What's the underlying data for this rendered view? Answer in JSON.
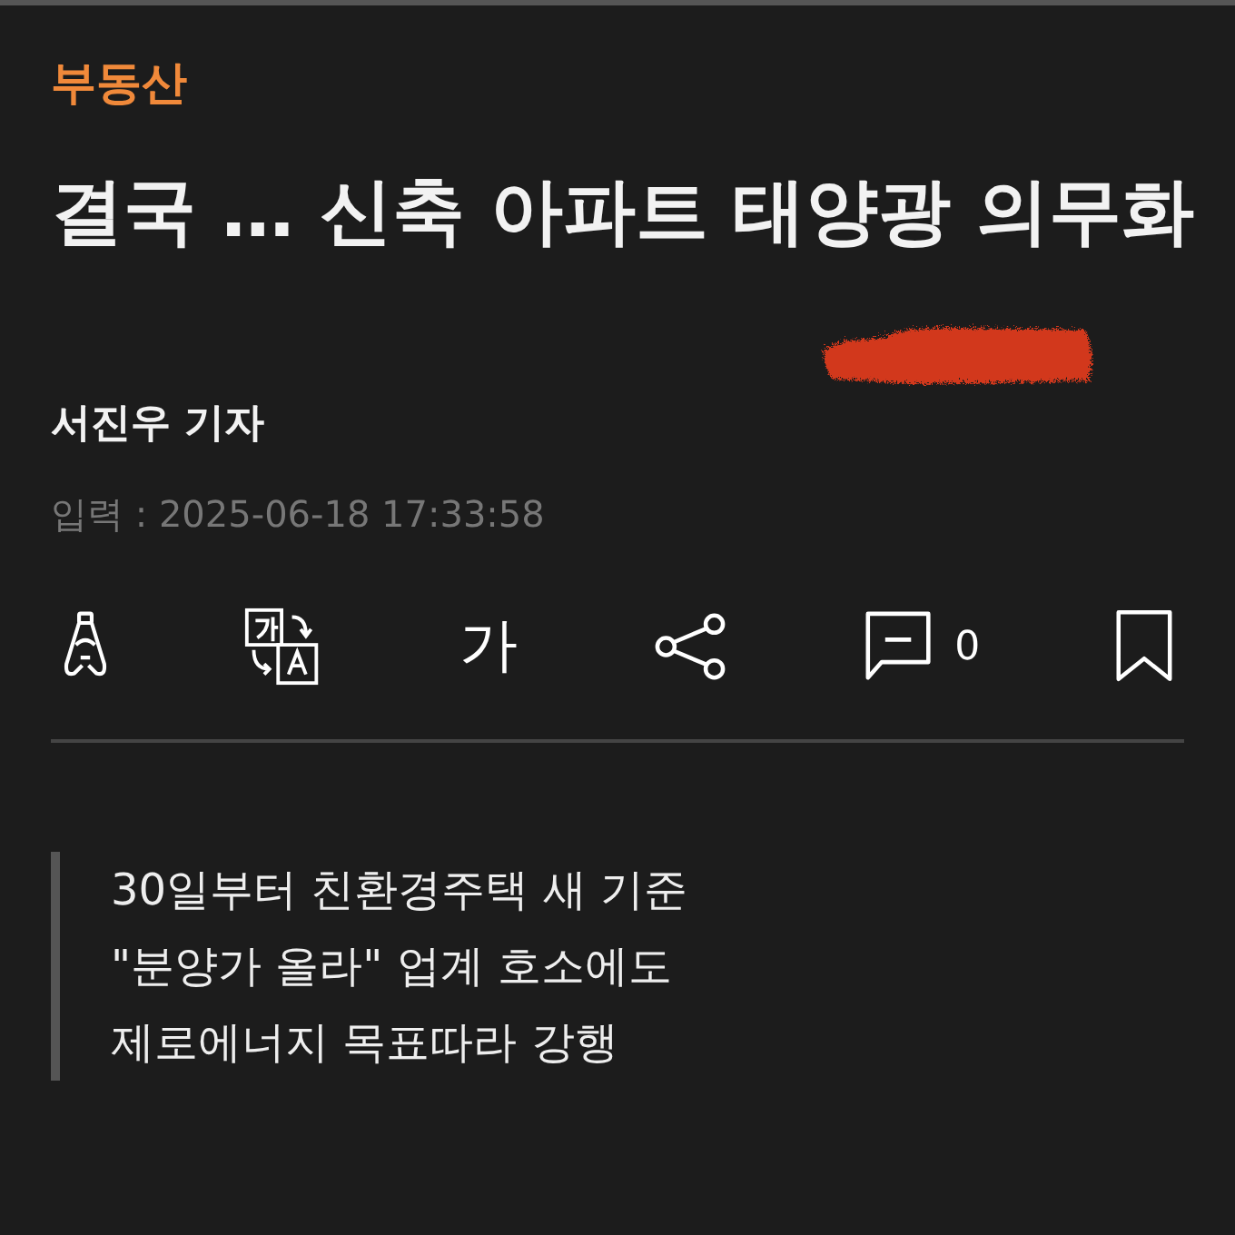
{
  "category": "부동산",
  "title": "결국 … 신축 아파트 태양광 의무화",
  "author": "서진우 기자",
  "published": "입력 : 2025-06-18 17:33:58",
  "toolbar": {
    "font_size_label": "가",
    "comment_count": "0"
  },
  "summary": [
    "30일부터 친환경주택 새 기준",
    "\"분양가 올라\" 업계 호소에도",
    "제로에너지 목표따라 강행"
  ]
}
